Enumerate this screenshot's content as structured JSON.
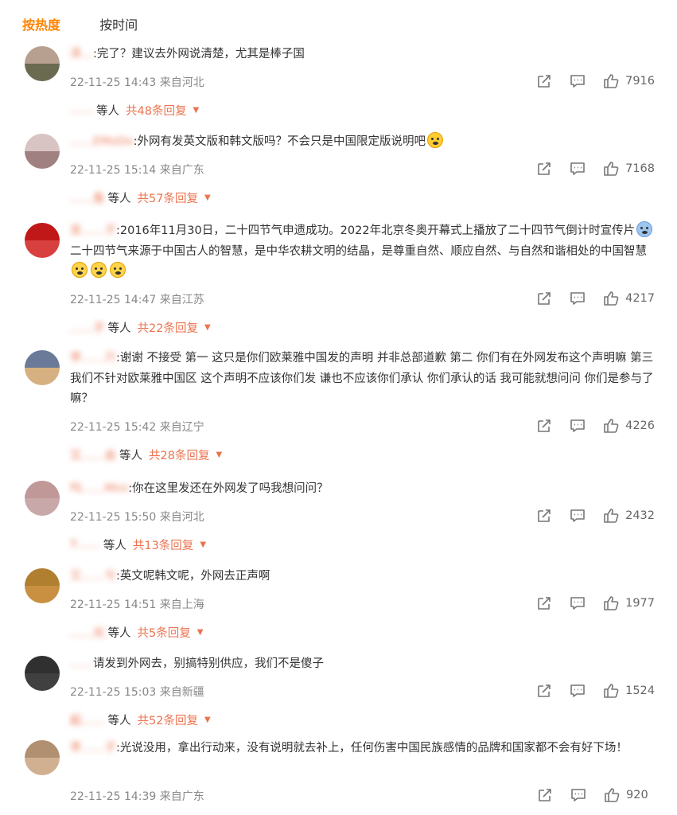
{
  "tabs": [
    {
      "label": "按热度"
    },
    {
      "label": "按时间"
    }
  ],
  "comments": [
    {
      "name": "泽…",
      "text": ":完了？建议去外网说清楚，尤其是棒子国",
      "meta": "22-11-25 14:43 来自河北",
      "likes": "7916",
      "reply_names": "……",
      "reply_suffix": "等人",
      "reply_count": "共48条回复",
      "avatar": [
        "#b8a090",
        "#6a6a50"
      ]
    },
    {
      "name": "……EMoDo",
      "text": ":外网有发英文版和韩文版吗？不会只是中国限定版说明吧",
      "meta": "22-11-25 15:14 来自广东",
      "likes": "7168",
      "reply_names": "……鱼",
      "reply_suffix": "等人",
      "reply_count": "共57条回复",
      "avatar": [
        "#d9c4c4",
        "#a08080"
      ]
    },
    {
      "name": "发……子",
      "text": ":2016年11月30日，二十四节气申遗成功。2022年北京冬奥开幕式上播放了二十四节气倒计时宣传片",
      "text2": "二十四节气来源于中国古人的智慧，是中华农耕文明的结晶，是尊重自然、顺应自然、与自然和谐相处的中国智慧",
      "meta": "22-11-25 14:47 来自江苏",
      "likes": "4217",
      "reply_names": "……子",
      "reply_suffix": "等人",
      "reply_count": "共22条回复",
      "avatar": [
        "#c01818",
        "#d84040"
      ]
    },
    {
      "name": "李……只",
      "text": ":谢谢 不接受 第一 这只是你们欧莱雅中国发的声明 并非总部道歉 第二 你们有在外网发布这个声明嘛 第三 我们不针对欧莱雅中国区 这个声明不应该你们发 谦也不应该你们承认 你们承认的话 我可能就想问问 你们是参与了嘛？",
      "meta": "22-11-25 15:42 来自辽宁",
      "likes": "4226",
      "reply_names": "又……会",
      "reply_suffix": "等人",
      "reply_count": "共28条回复",
      "avatar": [
        "#6a7a98",
        "#d6b080"
      ]
    },
    {
      "name": "吗……Mini",
      "text": ":你在这里发还在外网发了吗我想问问？",
      "meta": "22-11-25 15:50 来自河北",
      "likes": "2432",
      "reply_names": "Y……",
      "reply_suffix": "等人",
      "reply_count": "共13条回复",
      "avatar": [
        "#c09898",
        "#c8a8a8"
      ]
    },
    {
      "name": "又……兮",
      "text": ":英文呢韩文呢，外网去正声啊",
      "meta": "22-11-25 14:51 来自上海",
      "likes": "1977",
      "reply_names": "……光",
      "reply_suffix": "等人",
      "reply_count": "共5条回复",
      "avatar": [
        "#b08030",
        "#c89040"
      ]
    },
    {
      "name": "……",
      "text": "请发到外网去，别搞特别供应，我们不是傻子",
      "meta": "22-11-25 15:03 来自新疆",
      "likes": "1524",
      "reply_names": "起……",
      "reply_suffix": "等人",
      "reply_count": "共52条回复",
      "avatar": [
        "#303030",
        "#404040"
      ]
    },
    {
      "name": "李……子",
      "text": ":光说没用，拿出行动来，没有说明就去补上，任何伤害中国民族感情的品牌和国家都不会有好下场！",
      "meta": "22-11-25 14:39 来自广东",
      "likes": "920",
      "avatar": [
        "#b09070",
        "#d0b090"
      ]
    }
  ]
}
